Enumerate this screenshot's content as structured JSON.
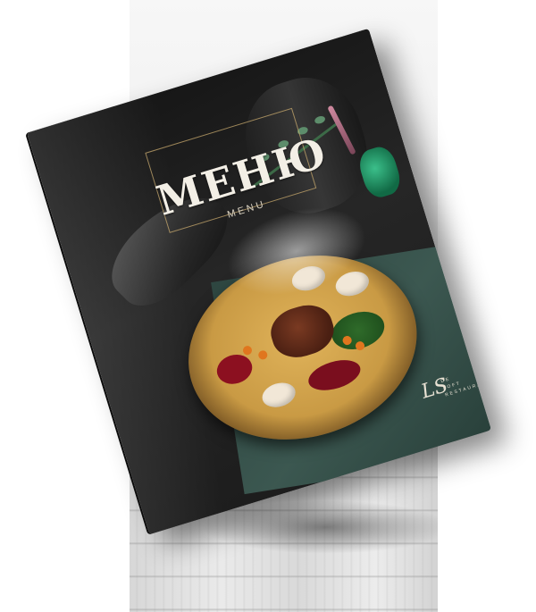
{
  "cover": {
    "title": "МЕНЮ",
    "subtitle": "MENU"
  },
  "logo": {
    "mark": "LS",
    "line1": "DE",
    "line2": "LOFT",
    "line3": "RESTAURANT"
  },
  "colors": {
    "cover_background": "#1e1e1e",
    "frame_gold": "#c8aa6e",
    "napkin_green": "#3f5e56",
    "plate_gold": "#c99a44",
    "sauce_red": "#8c1020"
  }
}
